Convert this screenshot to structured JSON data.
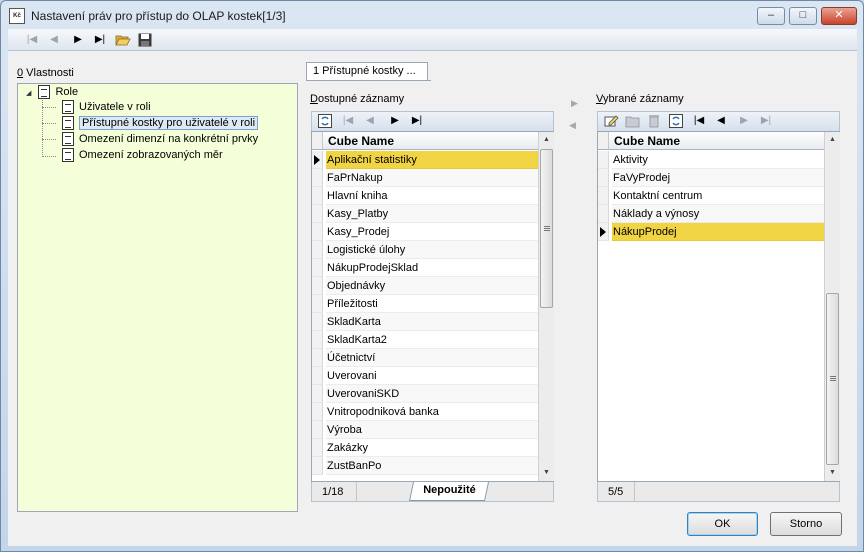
{
  "window": {
    "title": "Nastavení práv pro přístup do OLAP kostek[1/3]",
    "app_icon_text": "Kč",
    "controls": {
      "minimize": "–",
      "maximize": "□",
      "close": "✕"
    }
  },
  "toolbar": {
    "first": "|◀",
    "prev": "◀",
    "next": "▶",
    "last": "▶|",
    "open_icon": "folder-open-icon",
    "save_icon": "save-icon"
  },
  "left": {
    "header_mnemonic": "0",
    "header_rest": " Vlastnosti",
    "tree_expander": "◢",
    "tree_root": "Role",
    "tree_children": [
      "Uživatele v roli",
      "Přístupné kostky pro uživatelé v roli",
      "Omezení dimenzí na konkrétní prvky",
      "Omezení zobrazovaných měr"
    ]
  },
  "tab": {
    "label": "1 Přístupné kostky ..."
  },
  "available": {
    "label_mnemonic": "D",
    "label_rest": "ostupné záznamy",
    "column": "Cube Name",
    "rows": [
      "Aplikační statistiky",
      "FaPrNakup",
      "Hlavní kniha",
      "Kasy_Platby",
      "Kasy_Prodej",
      "Logistické úlohy",
      "NákupProdejSklad",
      "Objednávky",
      "Příležitosti",
      "SkladKarta",
      "SkladKarta2",
      "Účetnictví",
      "Uverovani",
      "UverovaniSKD",
      "Vnitropodniková banka",
      "Výroba",
      "Zakázky",
      "ZustBanPo"
    ],
    "counter": "1/18",
    "footer_tab": "Nepoužité"
  },
  "selected": {
    "label_mnemonic": "V",
    "label_rest": "ybrané záznamy",
    "column": "Cube Name",
    "rows": [
      "Aktivity",
      "FaVyProdej",
      "Kontaktní centrum",
      "Náklady a výnosy",
      "NákupProdej"
    ],
    "counter": "5/5"
  },
  "move": {
    "right": "▶",
    "left": "◀"
  },
  "grid_nav": {
    "first": "|◀",
    "prev": "◀",
    "next": "▶",
    "last": "▶|"
  },
  "buttons": {
    "ok": "OK",
    "cancel": "Storno"
  },
  "colors": {
    "selection": "#f0d443",
    "tree_bg": "#f4ffd9"
  }
}
